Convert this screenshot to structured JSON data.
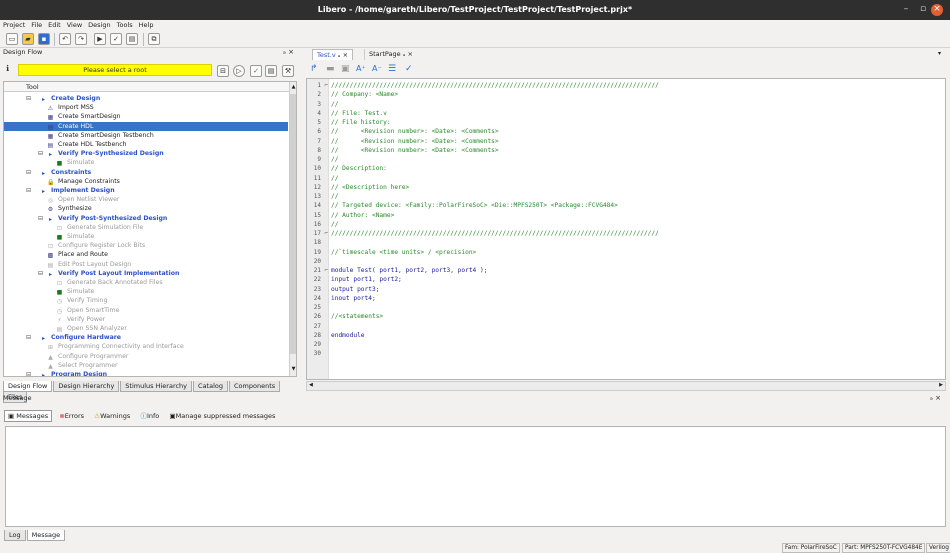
{
  "window": {
    "title": "Libero - /home/gareth/Libero/TestProject/TestProject/TestProject.prjx*"
  },
  "menu": [
    "Project",
    "File",
    "Edit",
    "View",
    "Design",
    "Tools",
    "Help"
  ],
  "design_flow": {
    "title": "Design Flow",
    "root_placeholder": "Please select a root",
    "column": "Tool",
    "rows": [
      {
        "label": "Create Design",
        "kind": "cat",
        "level": 0,
        "icon": "expand-arrow-icon"
      },
      {
        "label": "Import MSS",
        "kind": "tool",
        "level": 1,
        "icon": "import-icon"
      },
      {
        "label": "Create SmartDesign",
        "kind": "tool",
        "level": 1,
        "icon": "smartdesign-icon"
      },
      {
        "label": "Create HDL",
        "kind": "sel",
        "level": 1,
        "icon": "hdl-icon"
      },
      {
        "label": "Create SmartDesign Testbench",
        "kind": "tool",
        "level": 1,
        "icon": "testbench-icon"
      },
      {
        "label": "Create HDL Testbench",
        "kind": "tool",
        "level": 1,
        "icon": "hdl-testbench-icon"
      },
      {
        "label": "Verify Pre-Synthesized Design",
        "kind": "cat",
        "level": 1,
        "icon": "expand-arrow-icon"
      },
      {
        "label": "Simulate",
        "kind": "dis",
        "level": 2,
        "icon": "simulate-icon"
      },
      {
        "label": "Constraints",
        "kind": "cat",
        "level": 0,
        "icon": "expand-arrow-icon"
      },
      {
        "label": "Manage Constraints",
        "kind": "tool",
        "level": 1,
        "icon": "constraints-icon"
      },
      {
        "label": "Implement Design",
        "kind": "cat",
        "level": 0,
        "icon": "expand-arrow-icon"
      },
      {
        "label": "Open Netlist Viewer",
        "kind": "dis",
        "level": 1,
        "icon": "netlist-icon"
      },
      {
        "label": "Synthesize",
        "kind": "tool",
        "level": 1,
        "icon": "synthesize-icon"
      },
      {
        "label": "Verify Post-Synthesized Design",
        "kind": "cat",
        "level": 1,
        "icon": "expand-arrow-icon"
      },
      {
        "label": "Generate Simulation File",
        "kind": "dis",
        "level": 2,
        "icon": "generate-icon"
      },
      {
        "label": "Simulate",
        "kind": "dis",
        "level": 2,
        "icon": "simulate-icon"
      },
      {
        "label": "Configure Register Lock Bits",
        "kind": "dis",
        "level": 1,
        "icon": "lock-bits-icon"
      },
      {
        "label": "Place and Route",
        "kind": "tool",
        "level": 1,
        "icon": "place-route-icon"
      },
      {
        "label": "Edit Post Layout Design",
        "kind": "dis",
        "level": 1,
        "icon": "edit-layout-icon"
      },
      {
        "label": "Verify Post Layout Implementation",
        "kind": "cat",
        "level": 1,
        "icon": "expand-arrow-icon"
      },
      {
        "label": "Generate Back Annotated Files",
        "kind": "dis",
        "level": 2,
        "icon": "generate-icon"
      },
      {
        "label": "Simulate",
        "kind": "dis",
        "level": 2,
        "icon": "simulate-icon"
      },
      {
        "label": "Verify Timing",
        "kind": "dis",
        "level": 2,
        "icon": "timing-icon"
      },
      {
        "label": "Open SmartTime",
        "kind": "dis",
        "level": 2,
        "icon": "smarttime-icon"
      },
      {
        "label": "Verify Power",
        "kind": "dis",
        "level": 2,
        "icon": "power-icon"
      },
      {
        "label": "Open SSN Analyzer",
        "kind": "dis",
        "level": 2,
        "icon": "ssn-icon"
      },
      {
        "label": "Configure Hardware",
        "kind": "cat",
        "level": 0,
        "icon": "expand-arrow-icon"
      },
      {
        "label": "Programming Connectivity and Interface",
        "kind": "dis",
        "level": 1,
        "icon": "connectivity-icon"
      },
      {
        "label": "Configure Programmer",
        "kind": "dis",
        "level": 1,
        "icon": "programmer-icon"
      },
      {
        "label": "Select Programmer",
        "kind": "dis",
        "level": 1,
        "icon": "programmer-icon"
      },
      {
        "label": "Program Design",
        "kind": "cat",
        "level": 0,
        "icon": "expand-arrow-icon"
      }
    ],
    "tabs": [
      "Design Flow",
      "Design Hierarchy",
      "Stimulus Hierarchy",
      "Catalog",
      "Components",
      "Files"
    ]
  },
  "editor": {
    "tabs": [
      "Test.v",
      "StartPage"
    ],
    "lines": [
      "////////////////////////////////////////////////////////////////////////////////////////",
      "// Company: <Name>",
      "//",
      "// File: Test.v",
      "// File history:",
      "//      <Revision number>: <Date>: <Comments>",
      "//      <Revision number>: <Date>: <Comments>",
      "//      <Revision number>: <Date>: <Comments>",
      "//",
      "// Description:",
      "//",
      "// <Description here>",
      "//",
      "// Targeted device: <Family::PolarFireSoC> <Die::MPFS250T> <Package::FCVG484>",
      "// Author: <Name>",
      "//",
      "////////////////////////////////////////////////////////////////////////////////////////",
      "",
      "//`timescale <time units> / <precision>",
      "",
      "module Test( port1, port2, port3, port4 );",
      "input port1, port2;",
      "output port3;",
      "inout port4;",
      "",
      "//<statements>",
      "",
      "endmodule",
      "",
      ""
    ]
  },
  "message": {
    "title": "Message",
    "filters": [
      "Messages",
      "Errors",
      "Warnings",
      "Info",
      "Manage suppressed messages"
    ],
    "bottom_tabs": [
      "Log",
      "Message"
    ]
  },
  "status": {
    "family": "Fam: PolarFireSoC",
    "part": "Part: MPFS250T-FCVG484E",
    "extra": "Verilog"
  },
  "colors": {
    "root_bg": "#ffff00",
    "selection": "#3973c7",
    "category": "#2b50c8",
    "comment": "#2a8a2a"
  }
}
